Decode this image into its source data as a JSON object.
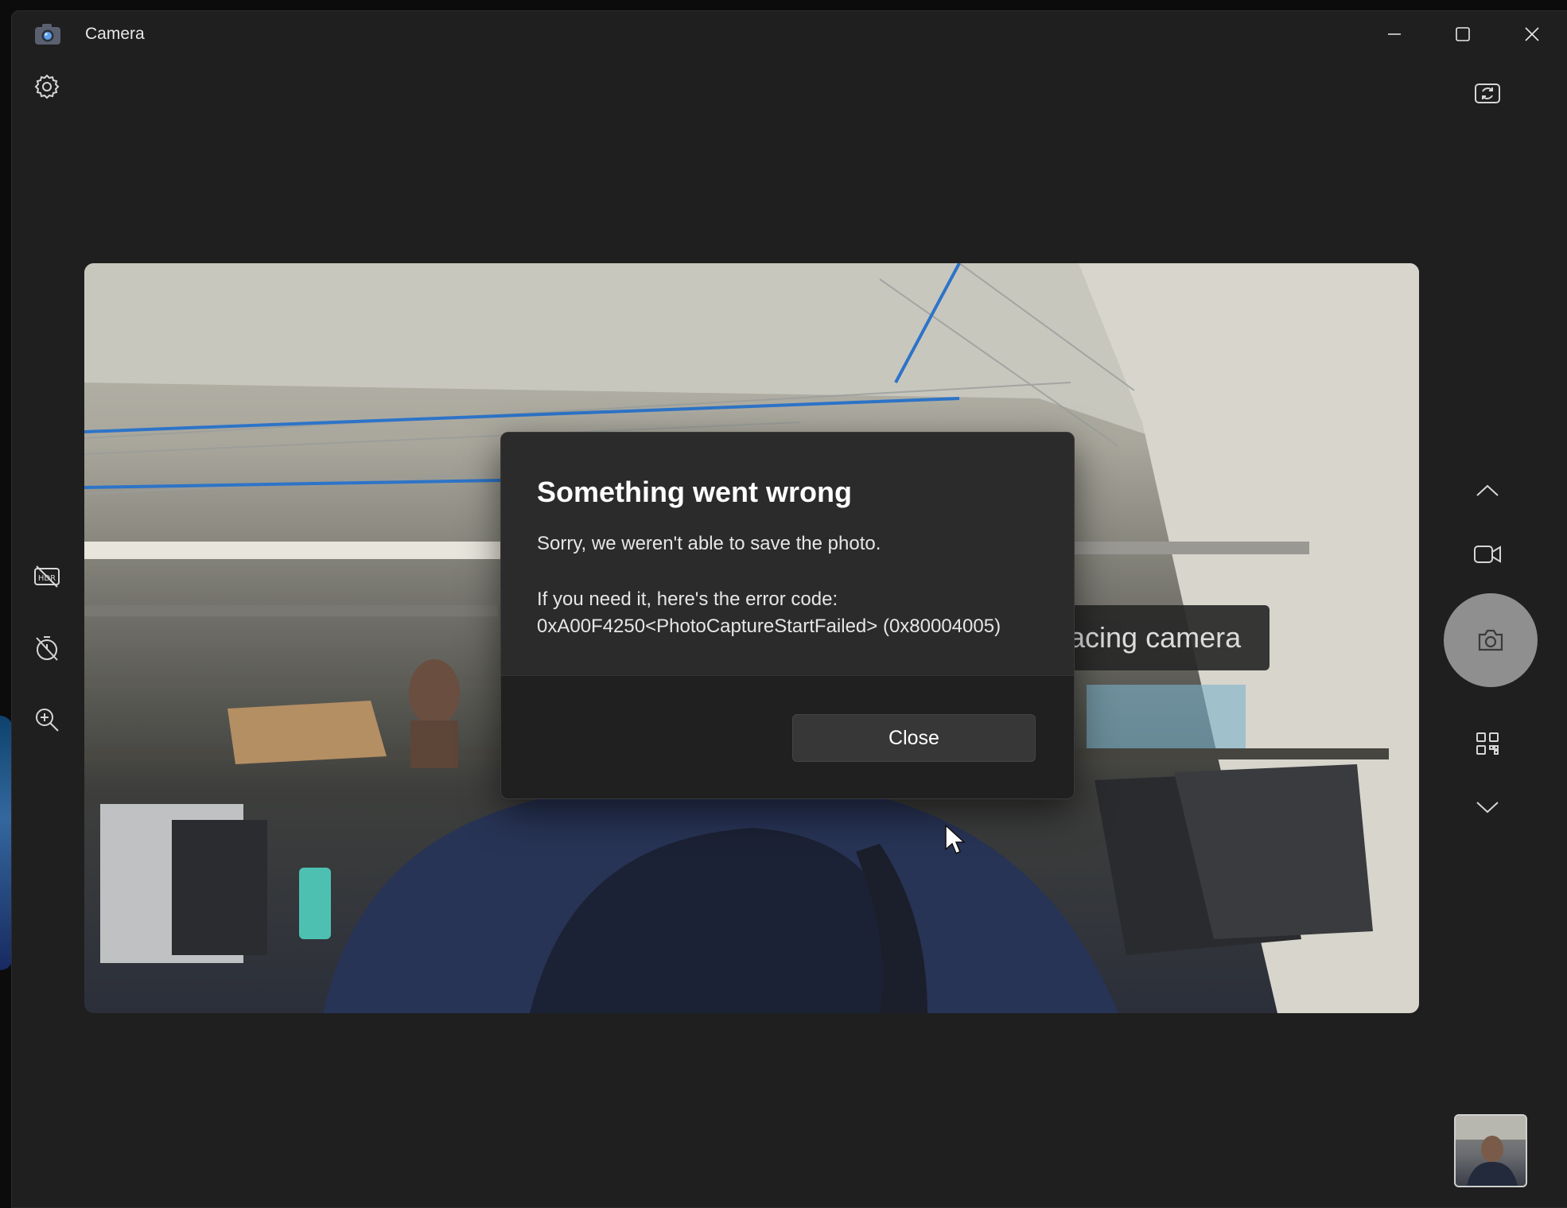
{
  "window": {
    "title": "Camera",
    "controls": [
      "minimize",
      "maximize",
      "close"
    ]
  },
  "toolbar": {
    "settings_icon": "gear-icon",
    "switch_camera_icon": "switch-camera-icon"
  },
  "left_rail": [
    {
      "name": "hdr-off-icon"
    },
    {
      "name": "timer-off-icon"
    },
    {
      "name": "zoom-icon"
    }
  ],
  "right_rail": {
    "mode_up_icon": "chevron-up-icon",
    "video_mode_icon": "video-camera-icon",
    "photo_shutter_icon": "camera-icon",
    "qr_scanner_icon": "qr-code-icon",
    "mode_down_icon": "chevron-down-icon"
  },
  "preview": {
    "overlay_label": "acing camera"
  },
  "dialog": {
    "title": "Something went wrong",
    "message": "Sorry, we weren't able to save the photo.",
    "hint": "If you need it, here's the error code:",
    "error_code": "0xA00F4250<PhotoCaptureStartFailed> (0x80004005)",
    "close_label": "Close"
  },
  "colors": {
    "window_bg": "#1f1f1f",
    "dialog_bg": "#2b2b2b",
    "dialog_footer": "#202020",
    "shutter": "#8f8f8f"
  }
}
